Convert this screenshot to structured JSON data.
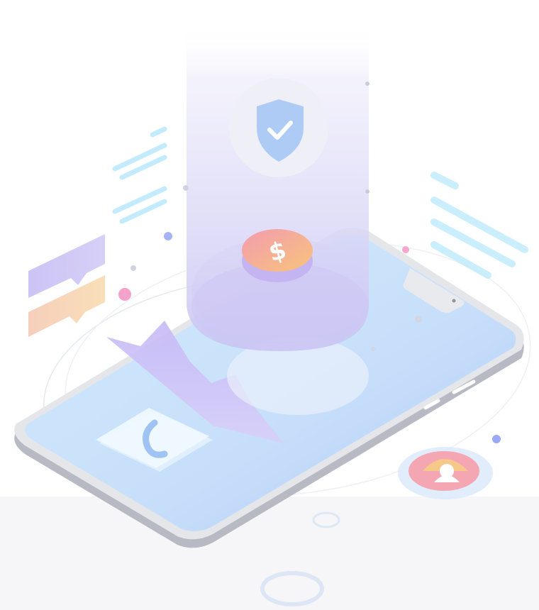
{
  "scene": {
    "description_free": true,
    "icons": {
      "shield": "shield-check-icon",
      "coin": "dollar-coin-icon",
      "phone_call": "phone-call-icon",
      "user": "user-avatar-icon",
      "speech_bubbles": "chat-bubbles-icon",
      "text_lines": "text-lines-icon",
      "mountain_chart": "mountain-chart-icon"
    },
    "colors": {
      "phone_screen": "#cfe6fb",
      "phone_screen_deep": "#b7cdf7",
      "phone_body": "#d9dbe0",
      "phone_frame_shadow": "#b9bcc4",
      "beam_top": "#f3f2fb",
      "beam_bottom": "#c9c4f3",
      "shield": "#a9c8f7",
      "coin_top": "#f6a86e",
      "coin_side": "#c7b3f5",
      "bubble_purple": "#c9c0f2",
      "bubble_orange": "#f6d0b0",
      "text_lines": "#b6e7fb",
      "accent_pink": "#f2a0c8",
      "accent_blue": "#9aa8f5"
    }
  }
}
